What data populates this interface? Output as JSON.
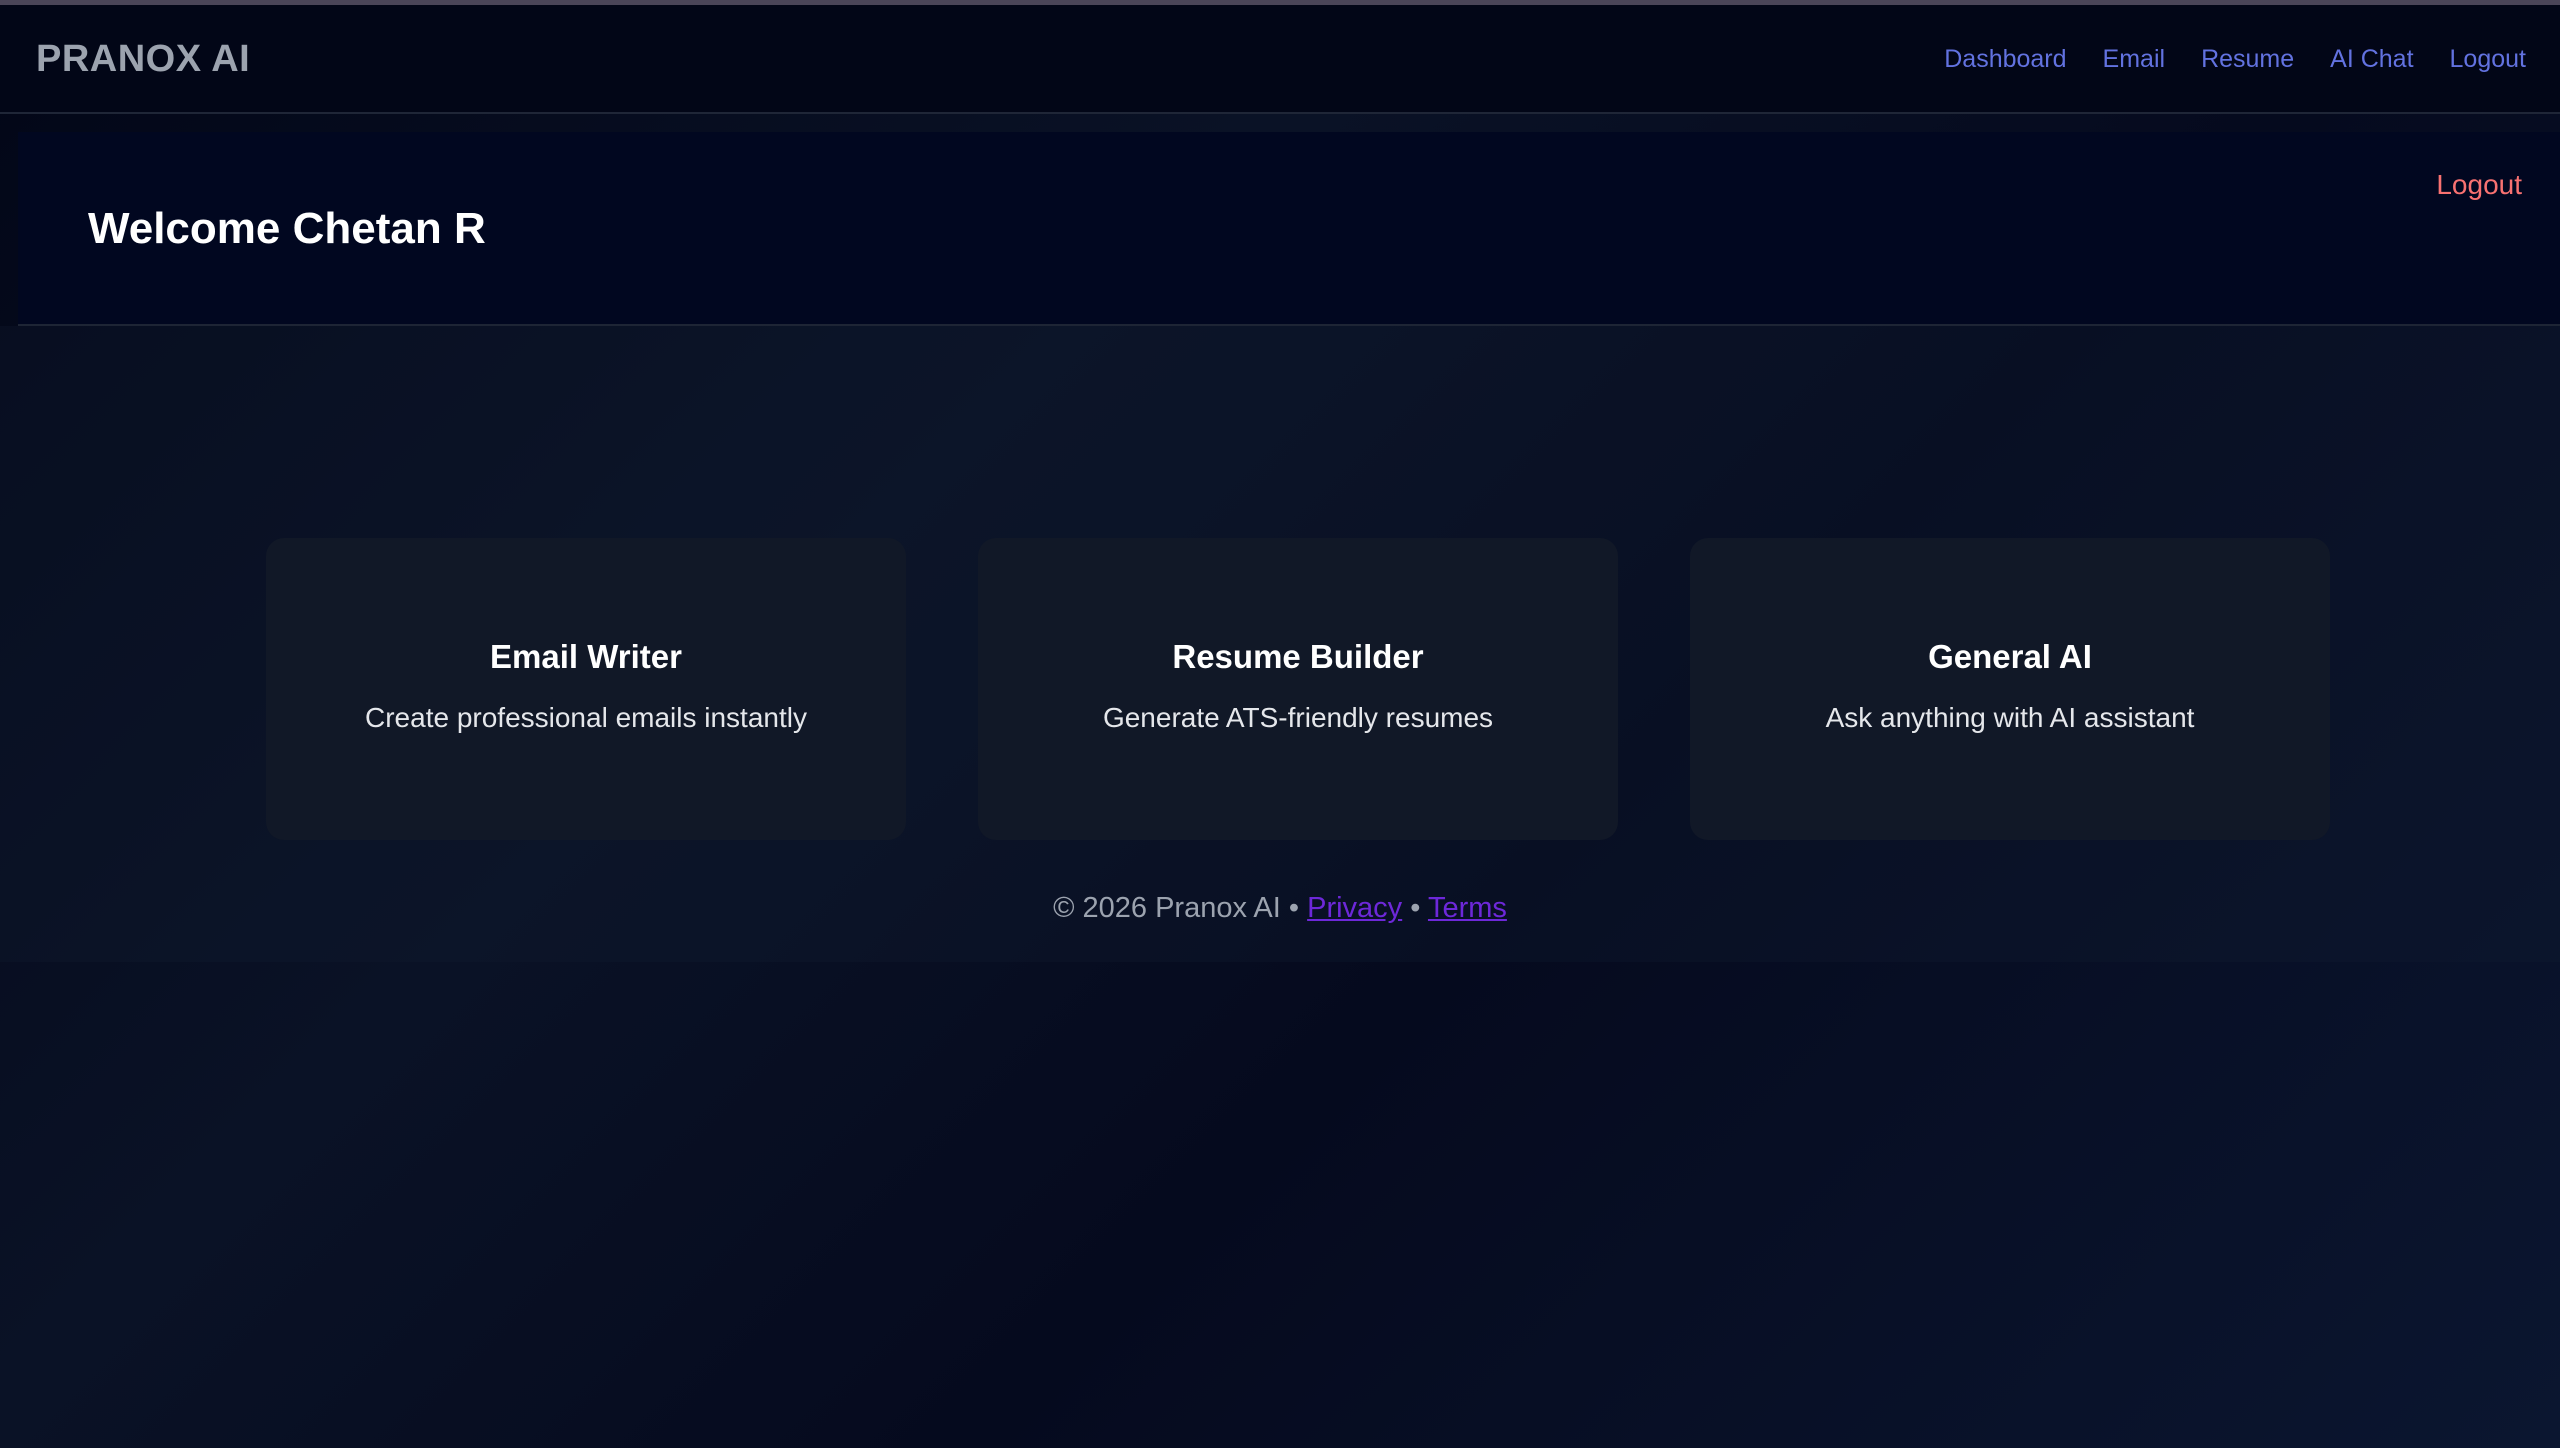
{
  "navbar": {
    "brand": "PRANOX AI",
    "links": [
      "Dashboard",
      "Email",
      "Resume",
      "AI Chat",
      "Logout"
    ]
  },
  "header": {
    "welcome": "Welcome Chetan R",
    "logout_label": "Logout"
  },
  "cards": [
    {
      "title": "Email Writer",
      "description": "Create professional emails instantly"
    },
    {
      "title": "Resume Builder",
      "description": "Generate ATS-friendly resumes"
    },
    {
      "title": "General AI",
      "description": "Ask anything with AI assistant"
    }
  ],
  "footer": {
    "copyright": "© 2026 Pranox AI",
    "separator": "•",
    "privacy_label": "Privacy",
    "terms_label": "Terms"
  },
  "colors": {
    "background": "#020617",
    "nav_link": "#6272e0",
    "logout_accent": "#f87171",
    "card_bg": "#111827",
    "footer_link": "#6d28d9"
  }
}
